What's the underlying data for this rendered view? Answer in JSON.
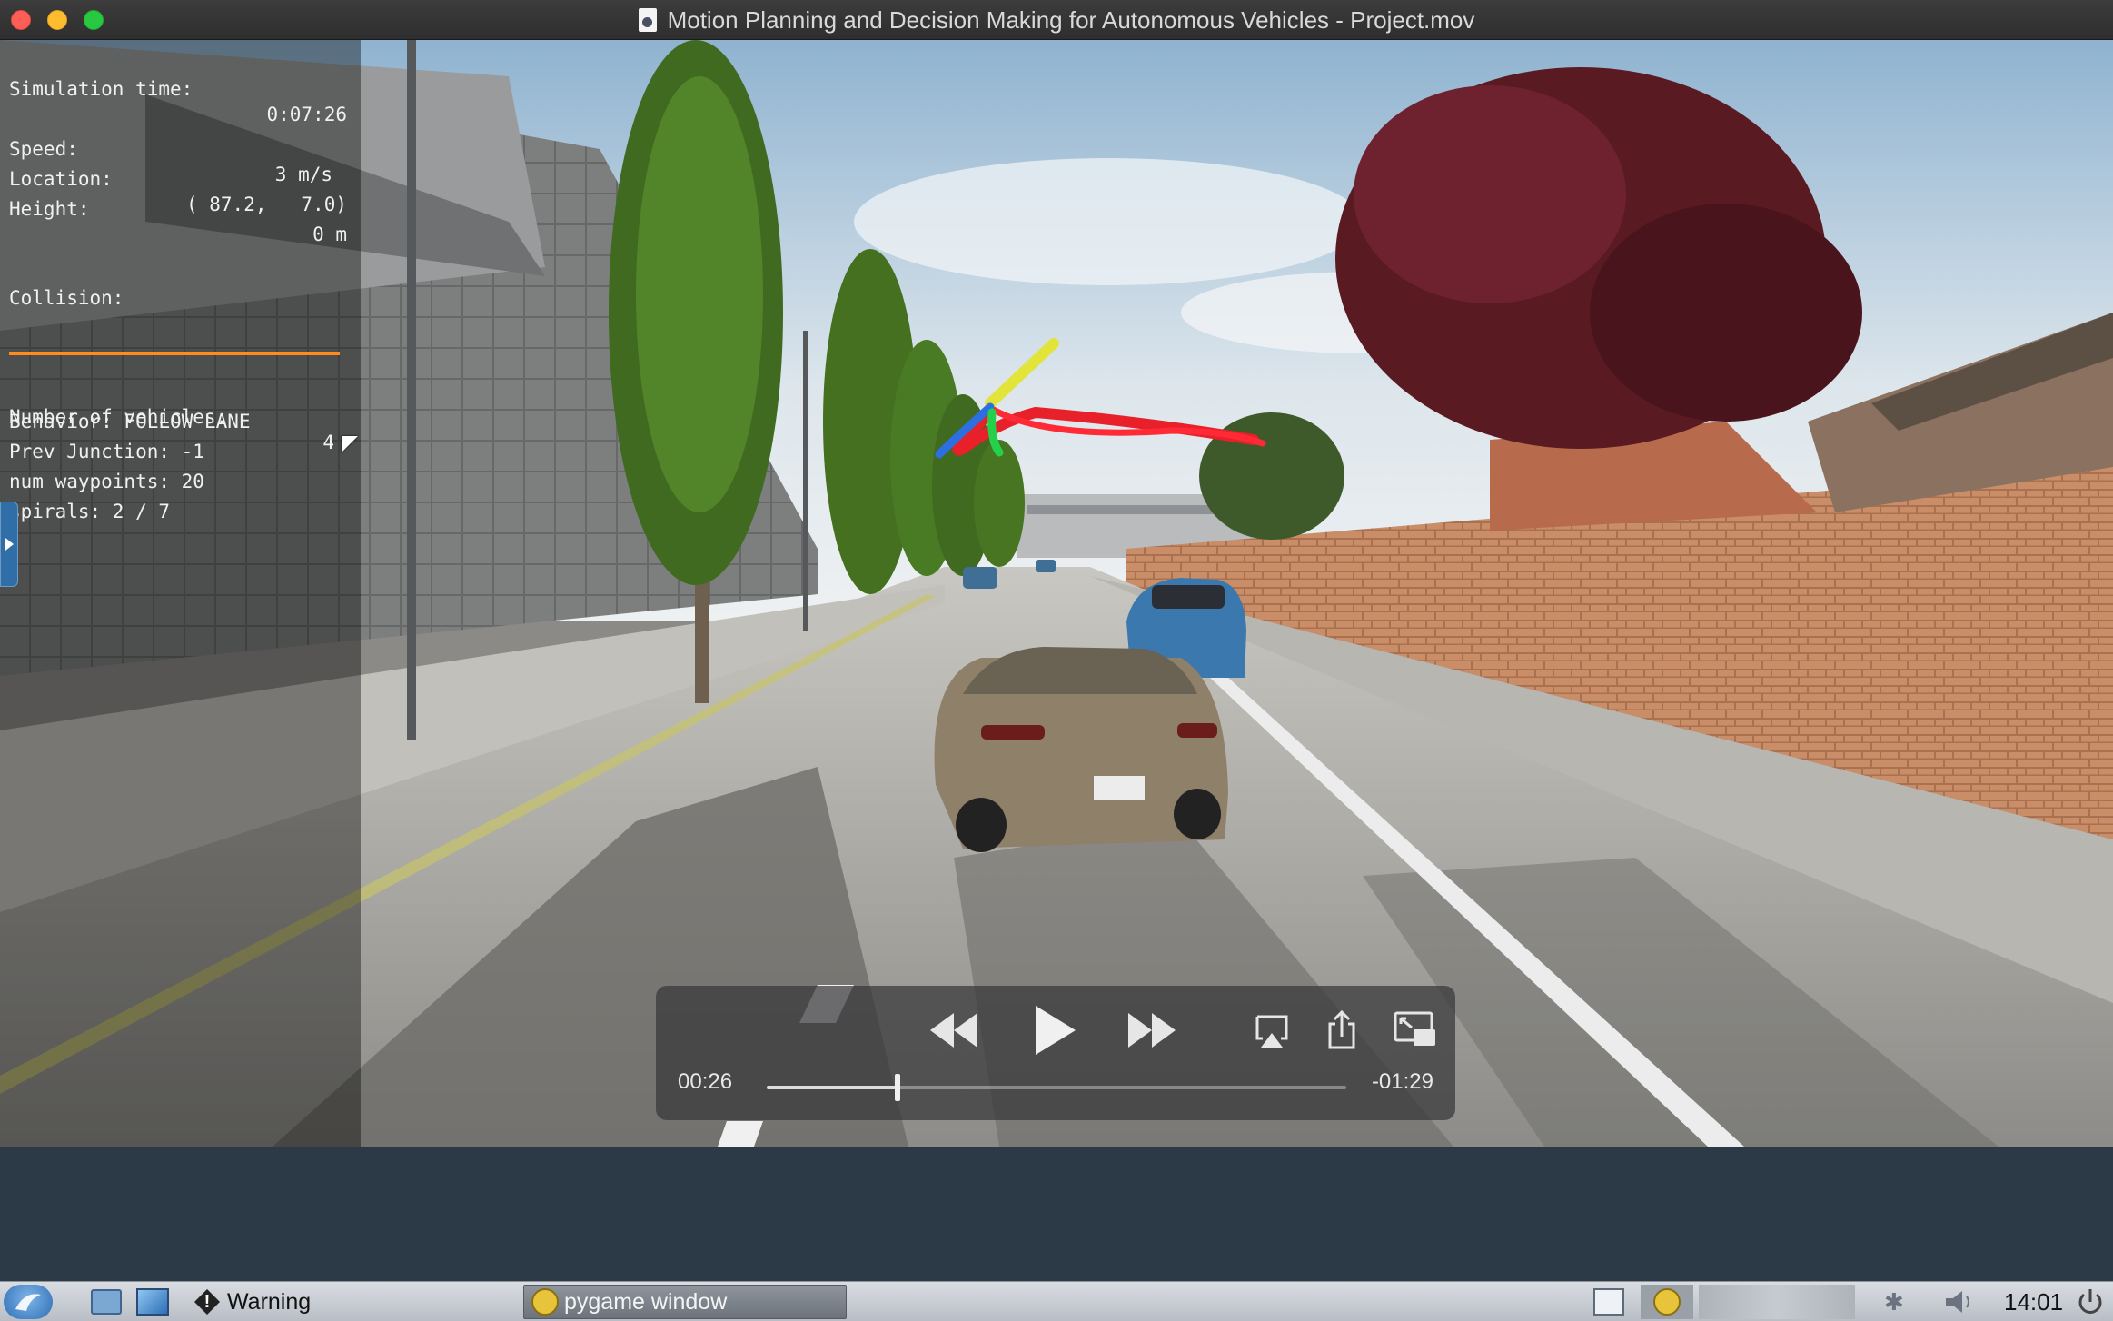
{
  "window": {
    "title": "Motion Planning and Decision Making for Autonomous Vehicles - Project.mov",
    "title_icon": "quicktime-doc-icon"
  },
  "hud": {
    "simulation_time_label": "Simulation time:",
    "simulation_time_value": "0:07:26",
    "speed_label": "Speed:",
    "speed_value": "3 m/s",
    "location_label": "Location:",
    "location_value": "( 87.2,   7.0)",
    "height_label": "Height:",
    "height_value": "0 m",
    "collision_label": "Collision:",
    "vehicles_label": "Number of vehicles:",
    "vehicles_value": "4",
    "behavior": "Behavior: FOLLOW LANE",
    "prev_junction": "Prev Junction: -1",
    "num_waypoints": "num waypoints: 20",
    "spirals": "spirals: 2 / 7",
    "collision_bar_color": "#ff8a1e"
  },
  "player": {
    "elapsed": "00:26",
    "remaining": "-01:29",
    "progress": 0.226,
    "buttons": [
      "rewind",
      "play",
      "fast-forward",
      "airplay",
      "share",
      "picture-in-picture"
    ]
  },
  "taskbar": {
    "warning_label": "Warning",
    "pygame_label": "pygame window",
    "clock": "14:01"
  }
}
